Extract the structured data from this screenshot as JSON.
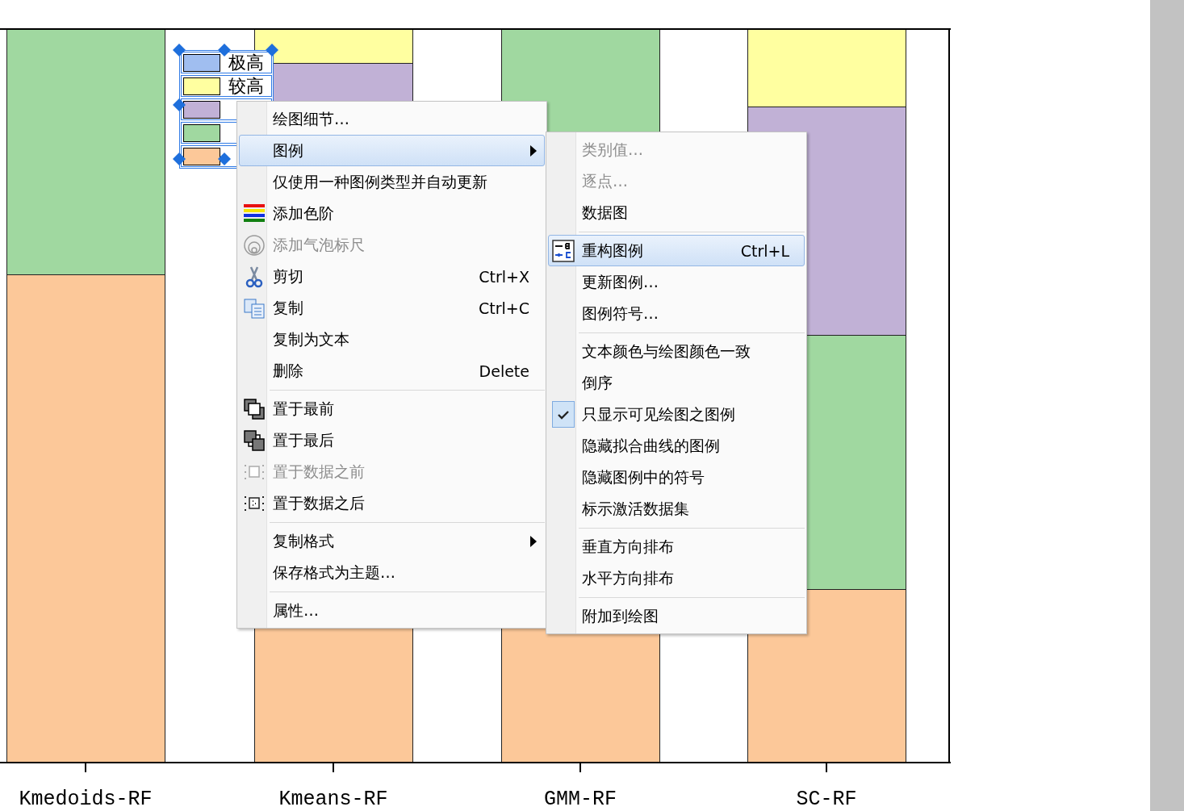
{
  "chart": {
    "legend": [
      {
        "label": "极高",
        "color": "#a0bef0"
      },
      {
        "label": "较高",
        "color": "#ffffa0"
      },
      {
        "color": "#c1b1d6"
      },
      {
        "color": "#a0d8a0"
      },
      {
        "color": "#fcc899"
      }
    ],
    "categories": [
      "Kmedoids-RF",
      "Kmeans-RF",
      "GMM-RF",
      "SC-RF"
    ]
  },
  "context_menu": {
    "items": [
      {
        "kind": "item",
        "label": "绘图细节…",
        "disabled": false,
        "selected": false
      },
      {
        "kind": "item",
        "label": "图例",
        "disabled": false,
        "selected": true,
        "submenu": true
      },
      {
        "kind": "item",
        "label": "仅使用一种图例类型并自动更新",
        "disabled": false,
        "selected": false
      },
      {
        "kind": "item",
        "label": "添加色阶",
        "disabled": false,
        "selected": false
      },
      {
        "kind": "item",
        "label": "添加气泡标尺",
        "disabled": true,
        "selected": false
      },
      {
        "kind": "item",
        "label": "剪切",
        "shortcut": "Ctrl+X",
        "disabled": false,
        "selected": false
      },
      {
        "kind": "item",
        "label": "复制",
        "shortcut": "Ctrl+C",
        "disabled": false,
        "selected": false
      },
      {
        "kind": "item",
        "label": "复制为文本",
        "disabled": false,
        "selected": false
      },
      {
        "kind": "item",
        "label": "删除",
        "shortcut": "Delete",
        "disabled": false,
        "selected": false
      },
      {
        "kind": "separator"
      },
      {
        "kind": "item",
        "label": "置于最前",
        "disabled": false,
        "selected": false
      },
      {
        "kind": "item",
        "label": "置于最后",
        "disabled": false,
        "selected": false
      },
      {
        "kind": "item",
        "label": "置于数据之前",
        "disabled": true,
        "selected": false
      },
      {
        "kind": "item",
        "label": "置于数据之后",
        "disabled": false,
        "selected": false
      },
      {
        "kind": "separator"
      },
      {
        "kind": "item",
        "label": "复制格式",
        "disabled": false,
        "selected": false,
        "submenu": true
      },
      {
        "kind": "item",
        "label": "保存格式为主题…",
        "disabled": false,
        "selected": false
      },
      {
        "kind": "separator"
      },
      {
        "kind": "item",
        "label": "属性…",
        "disabled": false,
        "selected": false
      }
    ]
  },
  "legend_submenu": {
    "items": [
      {
        "kind": "item",
        "label": "类别值…",
        "disabled": true,
        "selected": false,
        "checked": false
      },
      {
        "kind": "item",
        "label": "逐点…",
        "disabled": true,
        "selected": false,
        "checked": false
      },
      {
        "kind": "item",
        "label": "数据图",
        "disabled": false,
        "selected": false,
        "checked": false
      },
      {
        "kind": "separator"
      },
      {
        "kind": "item",
        "label": "重构图例",
        "shortcut": "Ctrl+L",
        "disabled": false,
        "selected": true,
        "checked": false
      },
      {
        "kind": "item",
        "label": "更新图例…",
        "disabled": false,
        "selected": false,
        "checked": false
      },
      {
        "kind": "item",
        "label": "图例符号…",
        "disabled": false,
        "selected": false,
        "checked": false
      },
      {
        "kind": "separator"
      },
      {
        "kind": "item",
        "label": "文本颜色与绘图颜色一致",
        "disabled": false,
        "selected": false,
        "checked": false
      },
      {
        "kind": "item",
        "label": "倒序",
        "disabled": false,
        "selected": false,
        "checked": false
      },
      {
        "kind": "item",
        "label": "只显示可见绘图之图例",
        "disabled": false,
        "selected": false,
        "checked": true
      },
      {
        "kind": "item",
        "label": "隐藏拟合曲线的图例",
        "disabled": false,
        "selected": false,
        "checked": false
      },
      {
        "kind": "item",
        "label": "隐藏图例中的符号",
        "disabled": false,
        "selected": false,
        "checked": false
      },
      {
        "kind": "item",
        "label": "标示激活数据集",
        "disabled": false,
        "selected": false,
        "checked": false
      },
      {
        "kind": "separator"
      },
      {
        "kind": "item",
        "label": "垂直方向排布",
        "disabled": false,
        "selected": false,
        "checked": false
      },
      {
        "kind": "item",
        "label": "水平方向排布",
        "disabled": false,
        "selected": false,
        "checked": false
      },
      {
        "kind": "separator"
      },
      {
        "kind": "item",
        "label": "附加到绘图",
        "disabled": false,
        "selected": false,
        "checked": false
      }
    ]
  }
}
